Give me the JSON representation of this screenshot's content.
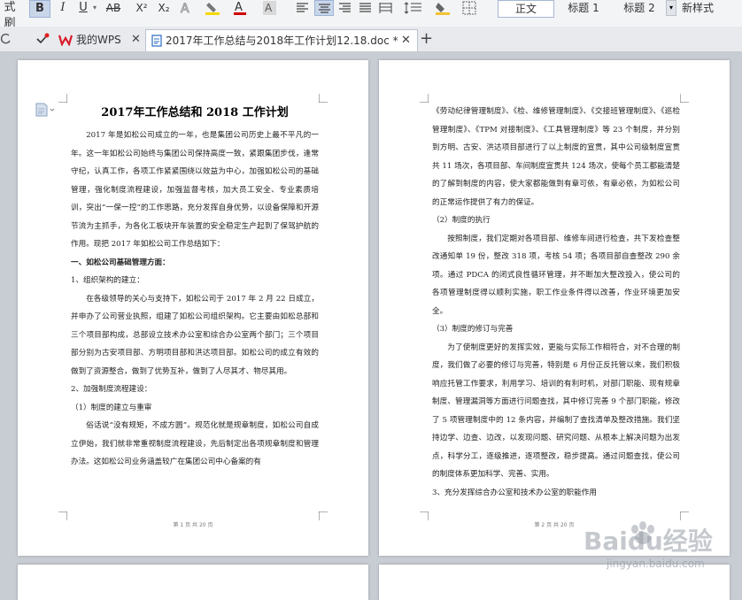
{
  "toolbar": {
    "left_clip": "式刷",
    "bold": "B",
    "italic": "I",
    "underline": "U",
    "strike": "AB",
    "superscript": "X²",
    "subscript": "X₂",
    "styles": [
      "正文",
      "标题 1",
      "标题 2"
    ],
    "new_style": "新样式",
    "colors": {
      "highlight": "#f5d800",
      "font": "#d00000",
      "shade": "#f1c232"
    }
  },
  "tabs": {
    "home": "我的WPS",
    "doc": "2017年工作总结与2018年工作计划12.18.doc *"
  },
  "page1": {
    "title": "2017年工作总结和 2018 工作计划",
    "paragraphs": [
      {
        "text": "2017 年是如松公司成立的一年，也是集团公司历史上最不平凡的一年。这一年如松公司始终与集团公司保持高度一致，紧跟集团步伐，逢常守纪，认真工作，各项工作紧紧围绕以效益为中心，加强如松公司的基础管理，强化制度流程建设，加强监督考核，加大员工安全、专业素质培训，突出“一保一控”的工作思路，充分发挥自身优势，以设备保障和开源节流为主抓手，为各化工板块开车装置的安全稳定生产起到了保驾护航的作用。现把 2017 年如松公司工作总结如下：",
        "indent": true
      },
      {
        "text": "一、如松公司基础管理方面：",
        "bold": true
      },
      {
        "text": "1、组织架构的建立："
      },
      {
        "text": "在各级领导的关心与支持下，如松公司于 2017 年 2 月 22 日成立，并申办了公司营业执照，组建了如松公司组织架构。它主要由如松总部和三个项目部构成，总部设立技术办公室和综合办公室两个部门；三个项目部分别为古安项目部、方明项目部和洪达项目部。如松公司的成立有效的做到了资源整合，做到了优势互补，做到了人尽其才、物尽其用。",
        "indent": true
      },
      {
        "text": "2、加强制度流程建设："
      },
      {
        "text": "（1）制度的建立与重审"
      },
      {
        "text": "俗话说“没有规矩，不成方圆”。规范化就是规章制度，如松公司自成立伊始，我们就非常重视制度流程建设，先后制定出各项规章制度和管理办法。这如松公司业务涵盖较广在集团公司中心备案的有",
        "indent": true
      }
    ],
    "footer": "第 1 页 共 20 页"
  },
  "page2": {
    "paragraphs": [
      {
        "text": "《劳动纪律管理制度》、《检、维修管理制度》、《交接班管理制度》、《巡检管理制度》、《TPM 对接制度》、《工具管理制度》等 23 个制度，并分别到方明、古安、洪达项目部进行了以上制度的宣贯，其中公司级制度宣贯共 11 场次，各项目部、车间制度宣贯共 124 场次，使每个员工都能清楚的了解到制度的内容，使大家都能做到有章可依，有章必依，为如松公司的正常运作提供了有力的保证。"
      },
      {
        "text": "（2）制度的执行"
      },
      {
        "text": "按照制度，我们定期对各项目部、维修车间进行检查，共下发检查整改通知单 19 份，整改 318 项，考核 54 项；各项目部自查整改 290 余项。通过 PDCA 的闭式良性循环管理，并不断加大整改投入，使公司的各项管理制度得以顺利实施，职工作业条件得以改善，作业环境更加安全。",
        "indent": true
      },
      {
        "text": "（3）制度的修订与完善"
      },
      {
        "text": "为了使制度更好的发挥实效，更能与实际工作相符合，对不合理的制度，我们做了必要的修订与完善，特别是 6 月份正反托管以来，我们积极响应托管工作要求，利用学习、培训的有利时机，对部门职能、现有规章制度、管理漏洞等方面进行问题查找，其中修订完善 9 个部门职能，修改了 5 项管理制度中的 12 条内容，并编制了查找清单及整改措施。我们坚持边学、边查、边改，以发现问题、研究问题、从根本上解决问题为出发点，科学分工，逐级推进，逐项整改，稳步提高。通过问题查找，使公司的制度体系更加科学、完善、实用。",
        "indent": true
      },
      {
        "text": "3、充分发挥综合办公室和技术办公室的职能作用"
      }
    ],
    "footer": "第 2 页 共 20 页"
  },
  "watermark": {
    "brand": "Baidu经验",
    "url": "jingyan.baidu.com"
  }
}
